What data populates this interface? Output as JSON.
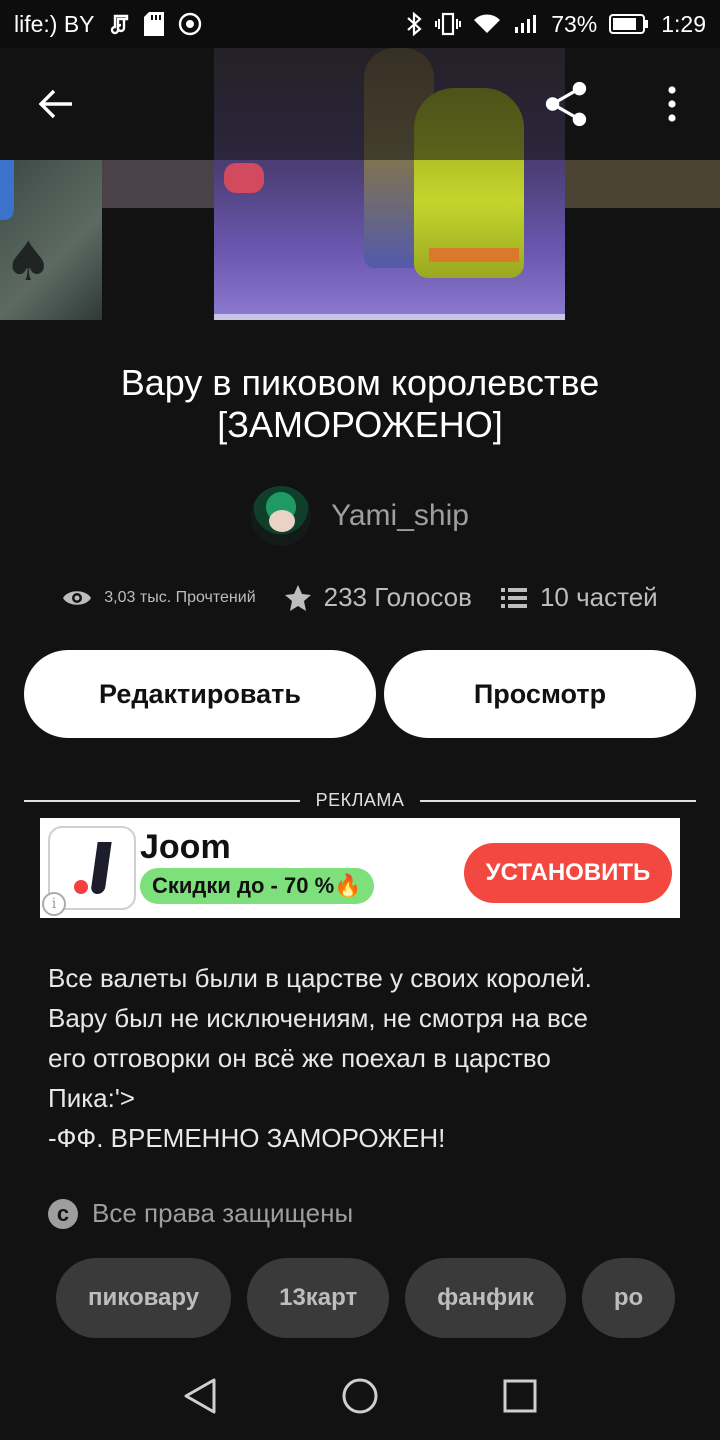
{
  "status_bar": {
    "carrier": "life:) BY",
    "battery": "73%",
    "time": "1:29",
    "icons": [
      "music-icon",
      "sd-card-icon",
      "hotspot-icon",
      "bluetooth-icon",
      "vibrate-icon",
      "wifi-icon",
      "signal-icon",
      "battery-icon"
    ]
  },
  "toolbar": {
    "icons": [
      "back-arrow-icon",
      "share-icon",
      "more-vert-icon"
    ]
  },
  "story": {
    "title_line1": "Вару в пиковом королевстве",
    "title_line2": "[ЗАМОРОЖЕНО]",
    "author": "Yami_ship",
    "reads": "3,03 тыс. Прочтений",
    "votes": "233 Голосов",
    "parts": "10 частей",
    "description": [
      "Все валеты были в царстве у своих королей.",
      "Вару был не исключениям, не смотря на все",
      "его отговорки он всё же поехал в царство",
      "Пика:'>",
      "-ФФ. ВРЕМЕННО ЗАМОРОЖЕН!"
    ],
    "copyright": "Все права защищены",
    "tags": [
      "пиковару",
      "13карт",
      "фанфик",
      "ро"
    ]
  },
  "actions": {
    "edit": "Редактировать",
    "view": "Просмотр"
  },
  "ad": {
    "label": "РЕКЛАМА",
    "app_name": "Joom",
    "subtitle": "Скидки до - 70 %🔥",
    "cta": "УСТАНОВИТЬ",
    "info_glyph": "i"
  },
  "colors": {
    "background": "#121212",
    "ad_cta": "#f2483f",
    "ad_badge": "#7ee07a",
    "tag_bg": "#3a3a3a"
  }
}
